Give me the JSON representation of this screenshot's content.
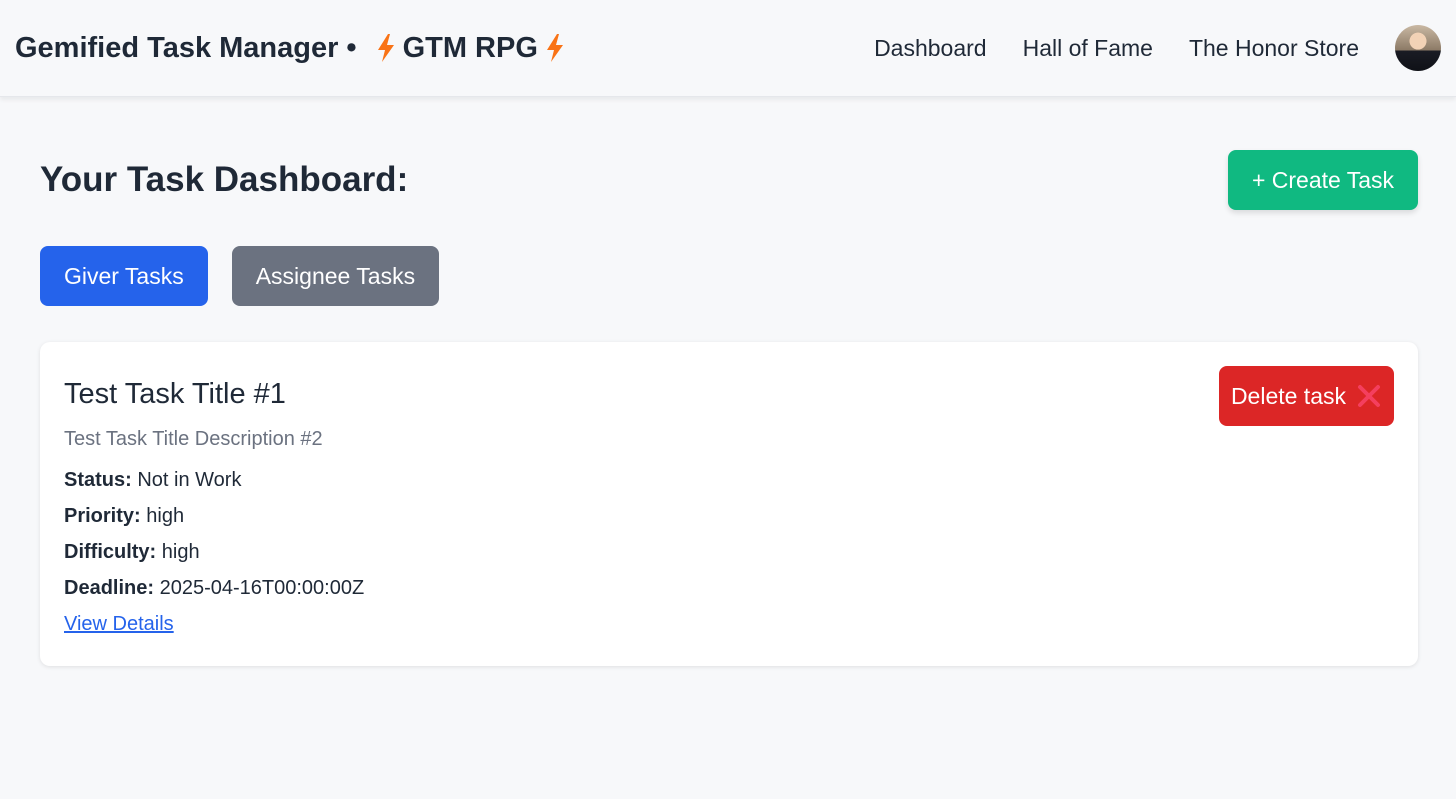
{
  "nav": {
    "brand_main": "Gemified Task Manager",
    "brand_sep": "•",
    "brand_game": "GTM RPG",
    "links": [
      "Dashboard",
      "Hall of Fame",
      "The Honor Store"
    ],
    "icons": [
      "lightning-bolt-icon",
      "avatar"
    ]
  },
  "page": {
    "title": "Your Task Dashboard:",
    "create_label": "+ Create Task"
  },
  "tabs": {
    "giver": "Giver Tasks",
    "assignee": "Assignee Tasks",
    "active": "Giver Tasks"
  },
  "task": {
    "title": "Test Task Title #1",
    "description": "Test Task Title Description #2",
    "status_label": "Status:",
    "status": "Not in Work",
    "priority_label": "Priority:",
    "priority": "high",
    "difficulty_label": "Difficulty:",
    "difficulty": "high",
    "deadline_label": "Deadline:",
    "deadline": "2025-04-16T00:00:00Z",
    "view_details": "View Details",
    "delete_label": "Delete task",
    "delete_icon": "cross-mark-icon"
  },
  "colors": {
    "primary": "#2563eb",
    "success": "#10b981",
    "danger": "#dc2626",
    "muted": "#6b7280",
    "bolt": "#f97316"
  }
}
